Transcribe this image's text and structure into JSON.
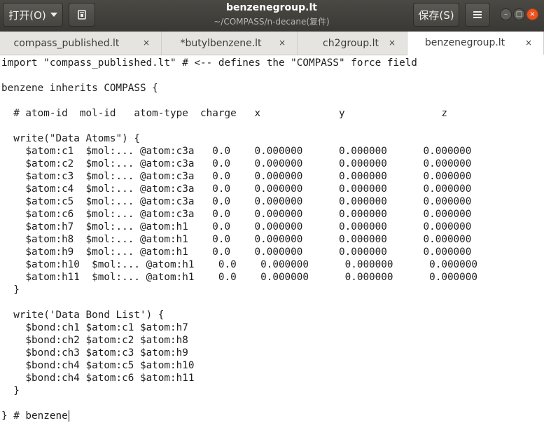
{
  "header": {
    "open_label": "打开(O)",
    "title": "benzenegroup.lt",
    "subtitle": "~/COMPASS/n-decane(复件)",
    "save_label": "保存(S)",
    "pin_icon": "document-pin-icon",
    "menu_icon": "hamburger-menu-icon",
    "window_controls": {
      "minimize": "–",
      "maximize": "□",
      "close": "×"
    }
  },
  "tabs": [
    {
      "label": "compass_published.lt",
      "close": "×",
      "active": false
    },
    {
      "label": "*butylbenzene.lt",
      "close": "×",
      "active": false
    },
    {
      "label": "ch2group.lt",
      "close": "×",
      "active": false
    },
    {
      "label": "benzenegroup.lt",
      "close": "×",
      "active": true
    }
  ],
  "editor": {
    "lines": [
      "import \"compass_published.lt\" # <-- defines the \"COMPASS\" force field",
      "",
      "benzene inherits COMPASS {",
      "",
      "  # atom-id  mol-id   atom-type  charge   x             y                z",
      "",
      "  write(\"Data Atoms\") {",
      "    $atom:c1  $mol:... @atom:c3a   0.0    0.000000      0.000000      0.000000",
      "    $atom:c2  $mol:... @atom:c3a   0.0    0.000000      0.000000      0.000000",
      "    $atom:c3  $mol:... @atom:c3a   0.0    0.000000      0.000000      0.000000",
      "    $atom:c4  $mol:... @atom:c3a   0.0    0.000000      0.000000      0.000000",
      "    $atom:c5  $mol:... @atom:c3a   0.0    0.000000      0.000000      0.000000",
      "    $atom:c6  $mol:... @atom:c3a   0.0    0.000000      0.000000      0.000000",
      "    $atom:h7  $mol:... @atom:h1    0.0    0.000000      0.000000      0.000000",
      "    $atom:h8  $mol:... @atom:h1    0.0    0.000000      0.000000      0.000000",
      "    $atom:h9  $mol:... @atom:h1    0.0    0.000000      0.000000      0.000000",
      "    $atom:h10  $mol:... @atom:h1    0.0    0.000000      0.000000      0.000000",
      "    $atom:h11  $mol:... @atom:h1    0.0    0.000000      0.000000      0.000000",
      "  }",
      "",
      "  write('Data Bond List') {",
      "    $bond:ch1 $atom:c1 $atom:h7",
      "    $bond:ch2 $atom:c2 $atom:h8",
      "    $bond:ch3 $atom:c3 $atom:h9",
      "    $bond:ch4 $atom:c5 $atom:h10",
      "    $bond:ch4 $atom:c6 $atom:h11",
      "  }",
      "",
      "} # benzene"
    ]
  }
}
